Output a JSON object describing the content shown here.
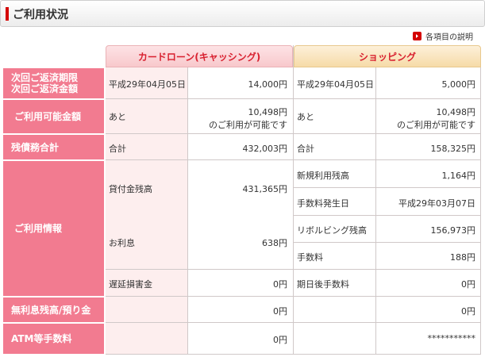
{
  "header": {
    "title": "ご利用状況",
    "help_link": "各項目の説明"
  },
  "columns": {
    "card_loan": "カードローン(キャッシング)",
    "shopping": "ショッピング"
  },
  "rows": {
    "due": {
      "label_line1": "次回ご返済期限",
      "label_line2": "次回ご返済金額"
    },
    "available": {
      "label": "ご利用可能金額"
    },
    "debt_total": {
      "label": "残債務合計"
    },
    "usage_info": {
      "label": "ご利用情報"
    },
    "no_interest": {
      "label": "無利息残高/預り金"
    },
    "atm_fee": {
      "label": "ATM等手数料"
    }
  },
  "card_loan": {
    "due_date": "平成29年04月05日",
    "due_amount": "14,000円",
    "available_prefix": "あと",
    "available_amount": "10,498円",
    "available_suffix": "のご利用が可能です",
    "total_label": "合計",
    "total_amount": "432,003円",
    "principal_label": "貸付金残高",
    "principal_amount": "431,365円",
    "interest_label": "お利息",
    "interest_amount": "638円",
    "late_label": "遅延損害金",
    "late_amount": "0円",
    "no_interest_amount": "0円",
    "atm_fee_amount": "0円"
  },
  "shopping": {
    "due_date": "平成29年04月05日",
    "due_amount": "5,000円",
    "available_prefix": "あと",
    "available_amount": "10,498円",
    "available_suffix": "のご利用が可能です",
    "total_label": "合計",
    "total_amount": "158,325円",
    "new_usage_label": "新規利用残高",
    "new_usage_amount": "1,164円",
    "fee_date_label": "手数料発生日",
    "fee_date_value": "平成29年03月07日",
    "revolving_label": "リボルビング残高",
    "revolving_amount": "156,973円",
    "fee_label": "手数料",
    "fee_amount": "188円",
    "post_due_fee_label": "期日後手数料",
    "post_due_fee_amount": "0円",
    "deposit_amount": "0円",
    "atm_fee_amount": "***********"
  }
}
